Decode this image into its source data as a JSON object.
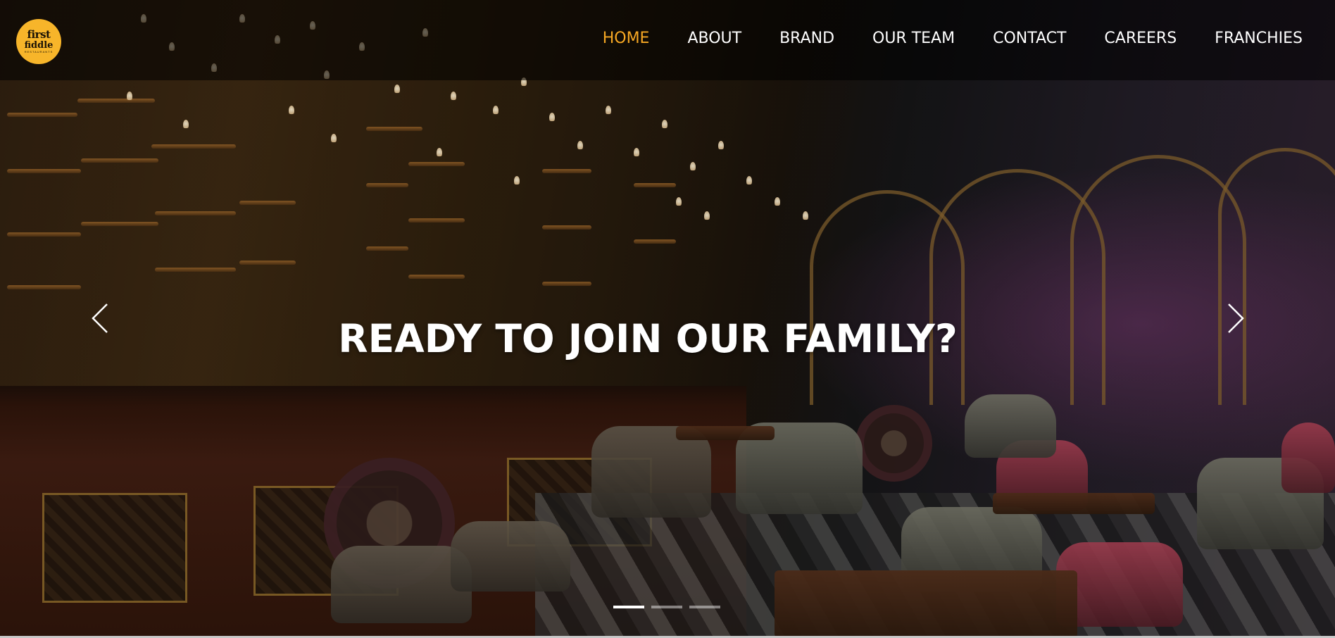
{
  "brand": {
    "logo_line1": "first",
    "logo_line2": "fiddle",
    "logo_line3": "RESTAURANTS",
    "accent_color": "#f7b52a"
  },
  "nav": {
    "items": [
      {
        "label": "HOME",
        "active": true
      },
      {
        "label": "ABOUT",
        "active": false
      },
      {
        "label": "BRAND",
        "active": false
      },
      {
        "label": "OUR TEAM",
        "active": false
      },
      {
        "label": "CONTACT",
        "active": false
      },
      {
        "label": "CAREERS",
        "active": false
      },
      {
        "label": "FRANCHIES",
        "active": false
      }
    ],
    "active_color": "#f7a823"
  },
  "hero": {
    "headline": "READY TO JOIN OUR FAMILY?",
    "prev_icon": "chevron-left-icon",
    "next_icon": "chevron-right-icon",
    "slides_count": 3,
    "active_slide": 1
  }
}
